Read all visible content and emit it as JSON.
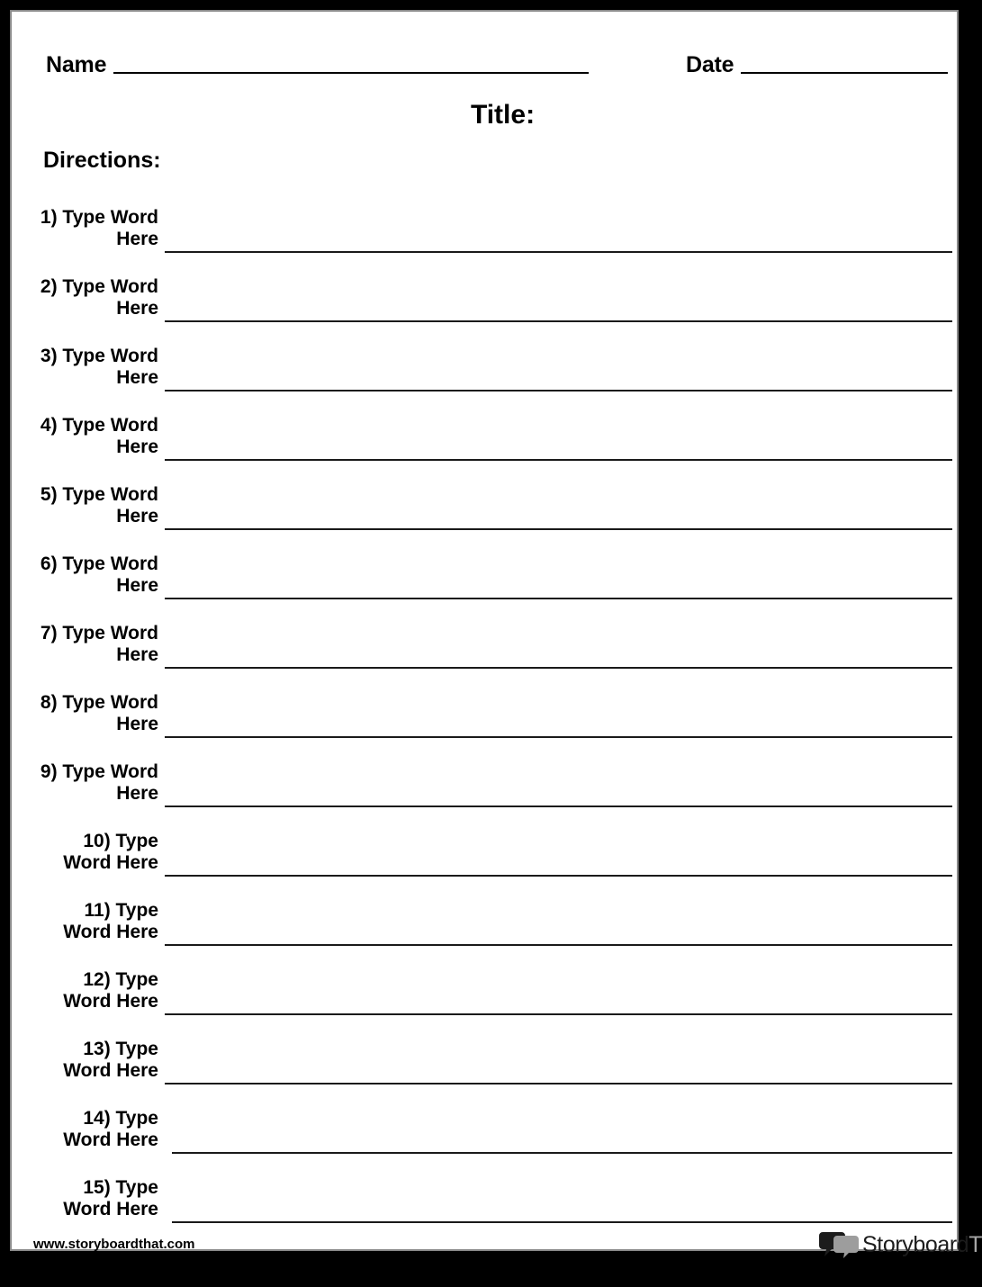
{
  "page": {
    "background_color": "#000000",
    "sheet_color": "#ffffff",
    "border_color": "#8a8a8a"
  },
  "header": {
    "name_label": "Name",
    "date_label": "Date",
    "title_label": "Title:",
    "directions_label": "Directions:"
  },
  "word_list": {
    "items": [
      {
        "label": "1) Type Word Here"
      },
      {
        "label": "2) Type Word Here"
      },
      {
        "label": "3) Type Word Here"
      },
      {
        "label": "4) Type Word Here"
      },
      {
        "label": "5) Type Word Here"
      },
      {
        "label": "6) Type Word Here"
      },
      {
        "label": "7) Type Word Here"
      },
      {
        "label": "8) Type Word Here"
      },
      {
        "label": "9) Type Word Here"
      },
      {
        "label": "10) Type Word Here"
      },
      {
        "label": "11) Type Word Here"
      },
      {
        "label": "12) Type Word Here"
      },
      {
        "label": "13) Type Word Here"
      },
      {
        "label": "14) Type Word Here"
      },
      {
        "label": "15) Type Word Here"
      }
    ]
  },
  "footer": {
    "url": "www.storyboardthat.com",
    "brand_primary": "Storyboard",
    "brand_secondary": "That",
    "logo_icon": "speech-bubbles-icon",
    "logo_primary_color": "#1c1c1c",
    "logo_secondary_color": "#a6a6a6"
  }
}
